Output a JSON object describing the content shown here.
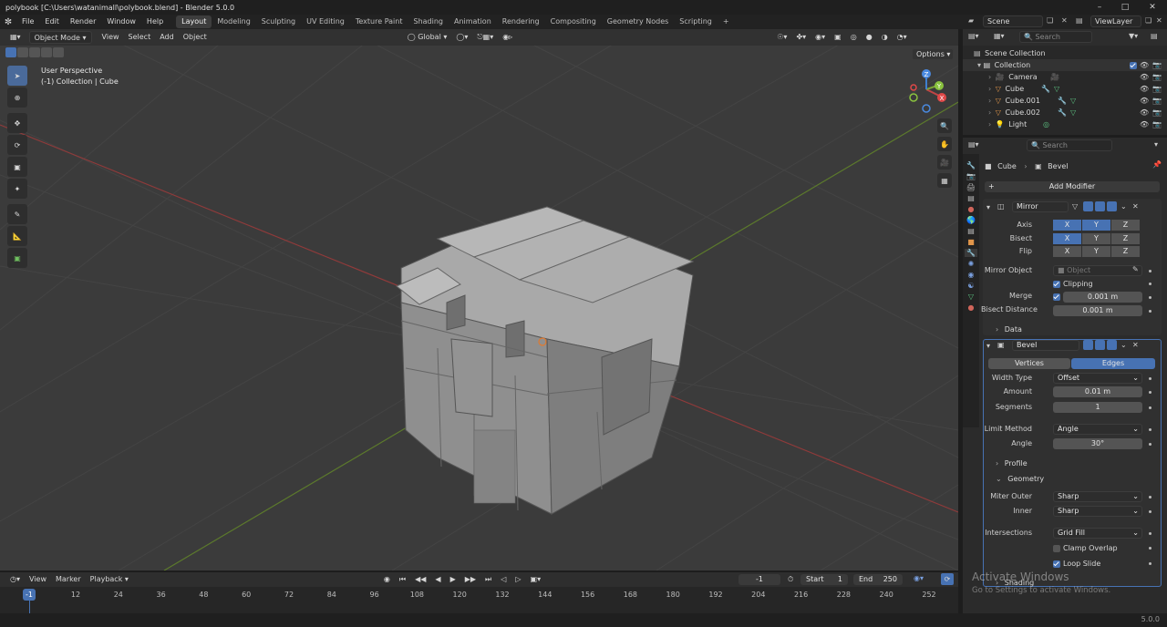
{
  "window": {
    "title": "polybook [C:\\Users\\watanimall\\polybook.blend] - Blender 5.0.0"
  },
  "menu": [
    "File",
    "Edit",
    "Render",
    "Window",
    "Help"
  ],
  "workspaces": [
    "Layout",
    "Modeling",
    "Sculpting",
    "UV Editing",
    "Texture Paint",
    "Shading",
    "Animation",
    "Rendering",
    "Compositing",
    "Geometry Nodes",
    "Scripting"
  ],
  "workspace_add": "+",
  "scene": {
    "name": "Scene",
    "view_layer": "ViewLayer"
  },
  "viewport": {
    "mode": "Object Mode",
    "menus": [
      "View",
      "Select",
      "Add",
      "Object"
    ],
    "transform_orientation": "Global",
    "info_line1": "User Perspective",
    "info_line2": "(-1) Collection | Cube",
    "options": "Options",
    "axis_x": "X",
    "axis_y": "Y",
    "axis_z": "Z"
  },
  "outliner": {
    "search_placeholder": "Search",
    "root": "Scene Collection",
    "collection": "Collection",
    "items": [
      "Camera",
      "Cube",
      "Cube.001",
      "Cube.002",
      "Light"
    ]
  },
  "properties": {
    "search_placeholder": "Search",
    "breadcrumb_object": "Cube",
    "breadcrumb_modifier": "Bevel",
    "add_modifier": "Add Modifier",
    "mirror": {
      "name": "Mirror",
      "axis_label": "Axis",
      "bisect_label": "Bisect",
      "flip_label": "Flip",
      "x": "X",
      "y": "Y",
      "z": "Z",
      "mirror_object_label": "Mirror Object",
      "mirror_object_placeholder": "Object",
      "clipping_label": "Clipping",
      "merge_label": "Merge",
      "merge_value": "0.001 m",
      "bisect_distance_label": "Bisect Distance",
      "bisect_distance_value": "0.001 m",
      "data_label": "Data"
    },
    "bevel": {
      "name": "Bevel",
      "vertices_tab": "Vertices",
      "edges_tab": "Edges",
      "width_type_label": "Width Type",
      "width_type_value": "Offset",
      "amount_label": "Amount",
      "amount_value": "0.01 m",
      "segments_label": "Segments",
      "segments_value": "1",
      "limit_method_label": "Limit Method",
      "limit_method_value": "Angle",
      "angle_label": "Angle",
      "angle_value": "30°",
      "profile_label": "Profile",
      "geometry_label": "Geometry",
      "miter_outer_label": "Miter Outer",
      "miter_outer_value": "Sharp",
      "inner_label": "Inner",
      "inner_value": "Sharp",
      "intersections_label": "Intersections",
      "intersections_value": "Grid Fill",
      "clamp_overlap_label": "Clamp Overlap",
      "loop_slide_label": "Loop Slide",
      "shading_label": "Shading"
    }
  },
  "timeline": {
    "menus": [
      "View",
      "Marker",
      "Playback"
    ],
    "current_frame": "-1",
    "start_label": "Start",
    "start_value": "1",
    "end_label": "End",
    "end_value": "250",
    "playhead": "-1",
    "ticks": [
      "12",
      "24",
      "36",
      "48",
      "60",
      "72",
      "84",
      "96",
      "108",
      "120",
      "132",
      "144",
      "156",
      "168",
      "180",
      "192",
      "204",
      "216",
      "228",
      "240",
      "252"
    ]
  },
  "watermark": {
    "line1": "Activate Windows",
    "line2": "Go to Settings to activate Windows."
  },
  "status": {
    "version": "5.0.0"
  },
  "colors": {
    "accent": "#4772b3",
    "viewport_bg": "#3b3b3b",
    "panel_bg": "#2b2b2b"
  }
}
